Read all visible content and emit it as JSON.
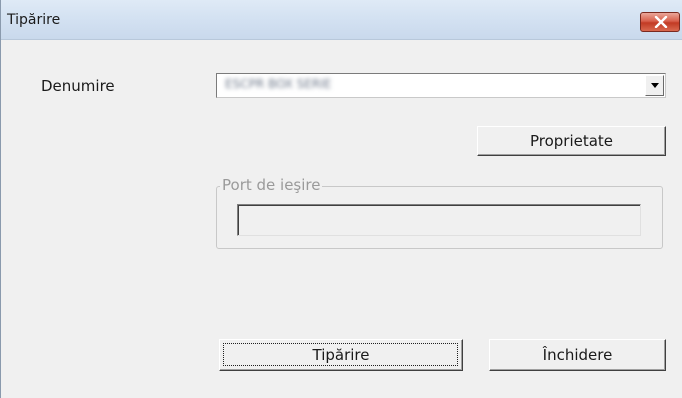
{
  "window": {
    "title": "Tipărire",
    "close_icon": "close-icon",
    "accent_close": "#c23a24"
  },
  "form": {
    "name_label": "Denumire",
    "printer_value": "ESCPR BOX SERIE",
    "properties_label": "Proprietate",
    "output_port_label": "Port de ieşire",
    "output_port_value": ""
  },
  "actions": {
    "print_label": "Tipărire",
    "close_label": "Închidere"
  }
}
